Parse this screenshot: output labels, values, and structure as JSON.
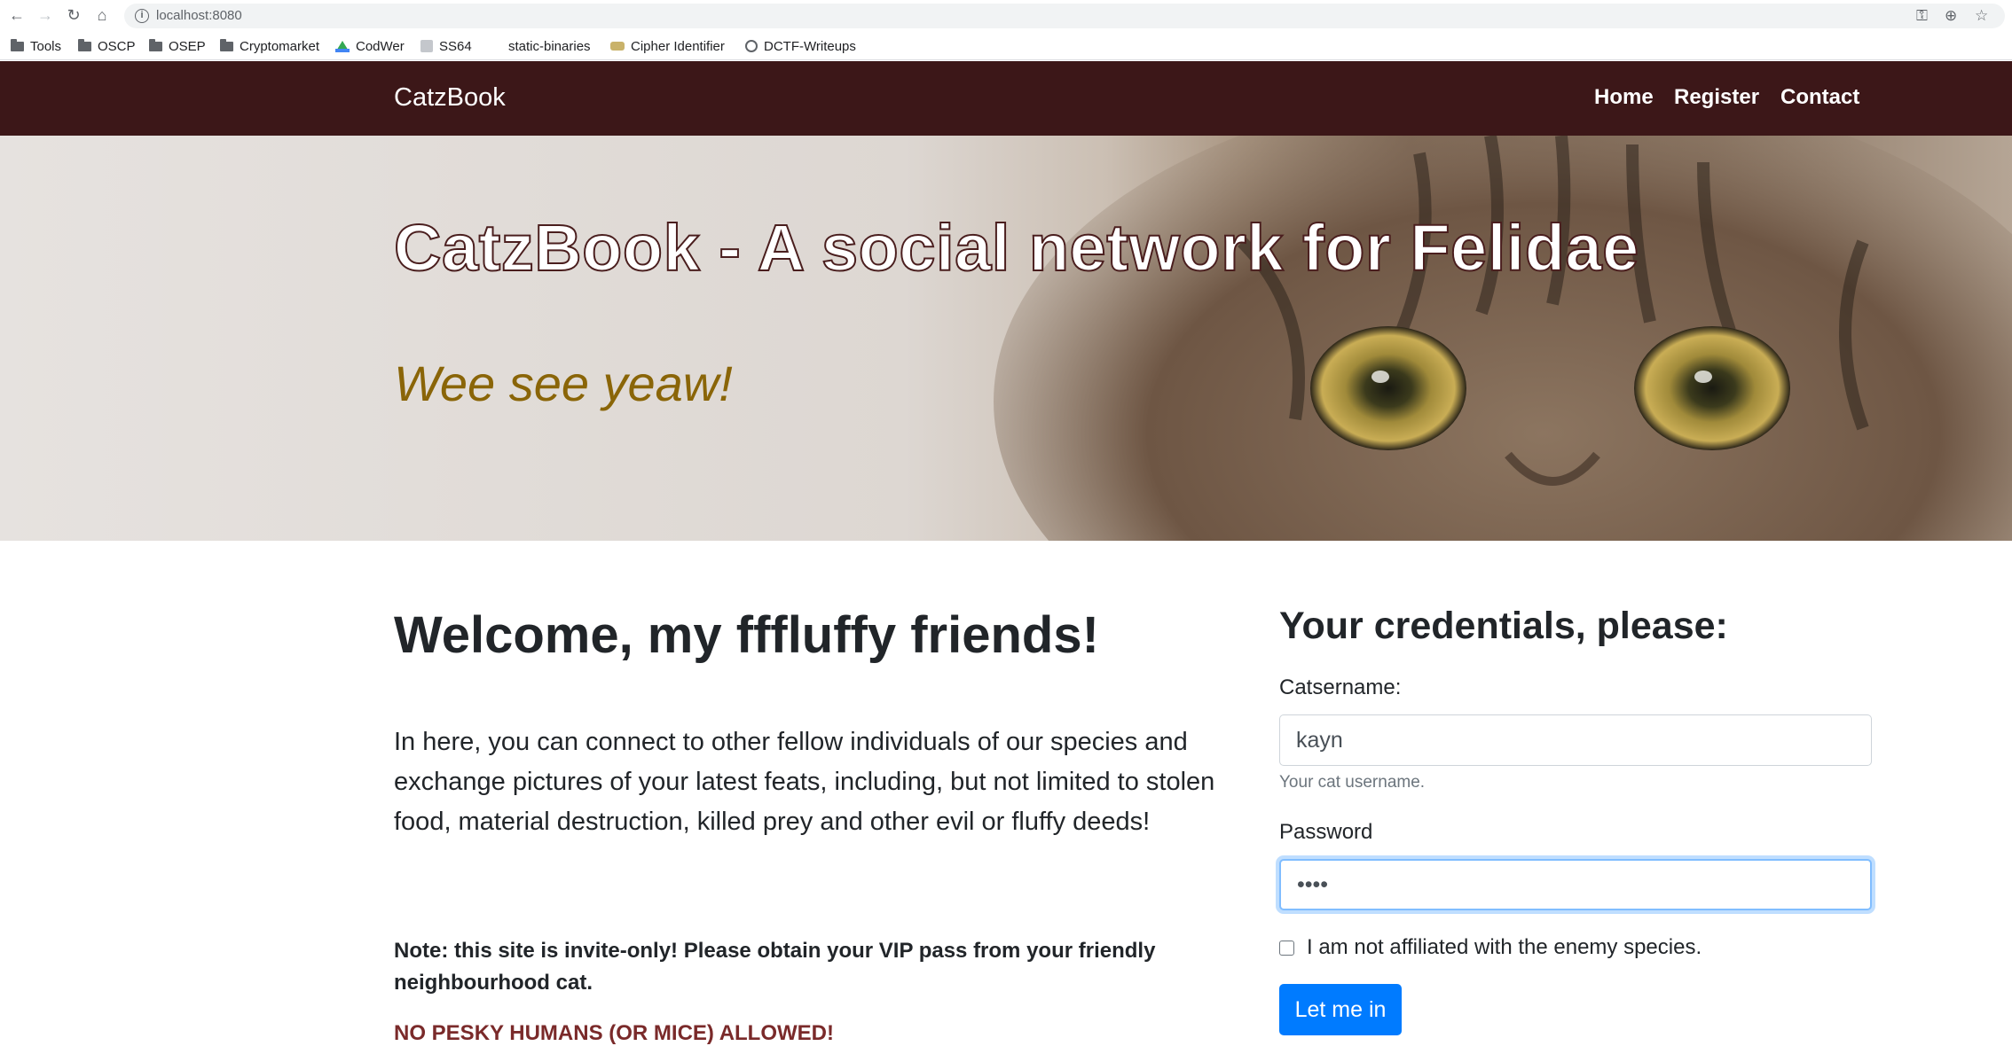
{
  "browser": {
    "url": "localhost:8080",
    "bookmarks": [
      {
        "label": "Tools",
        "icon": "folder-icon"
      },
      {
        "label": "OSCP",
        "icon": "folder-icon"
      },
      {
        "label": "OSEP",
        "icon": "folder-icon"
      },
      {
        "label": "Cryptomarket",
        "icon": "folder-icon"
      },
      {
        "label": "CodWer",
        "icon": "google-drive-icon"
      },
      {
        "label": "SS64",
        "icon": "page-icon"
      },
      {
        "label": "static-binaries",
        "icon": ""
      },
      {
        "label": "Cipher Identifier",
        "icon": "cipher-icon"
      },
      {
        "label": "DCTF-Writeups",
        "icon": "globe-icon"
      }
    ]
  },
  "navbar": {
    "brand": "CatzBook",
    "links": [
      "Home",
      "Register",
      "Contact"
    ],
    "background": "#3c1718"
  },
  "hero": {
    "title": "CatzBook - A social network for Felidae",
    "subtitle": "Wee see yeaw!",
    "subtitle_color": "#8a6508"
  },
  "main": {
    "welcome": "Welcome, my fffluffy friends!",
    "intro": "In here, you can connect to other fellow individuals of our species and exchange pictures of your latest feats, including, but not limited to stolen food, material destruction, killed prey and other evil or fluffy deeds!",
    "note": "Note: this site is invite-only! Please obtain your VIP pass from your friendly neighbourhood cat.",
    "warning": "NO PESKY HUMANS (OR MICE) ALLOWED!"
  },
  "form": {
    "title": "Your credentials, please:",
    "username_label": "Catsername:",
    "username_value": "kayn",
    "username_help": "Your cat username.",
    "password_label": "Password",
    "password_value": "••••",
    "checkbox_label": "I am not affiliated with the enemy species.",
    "submit_label": "Let me in",
    "accent": "#007bff"
  }
}
